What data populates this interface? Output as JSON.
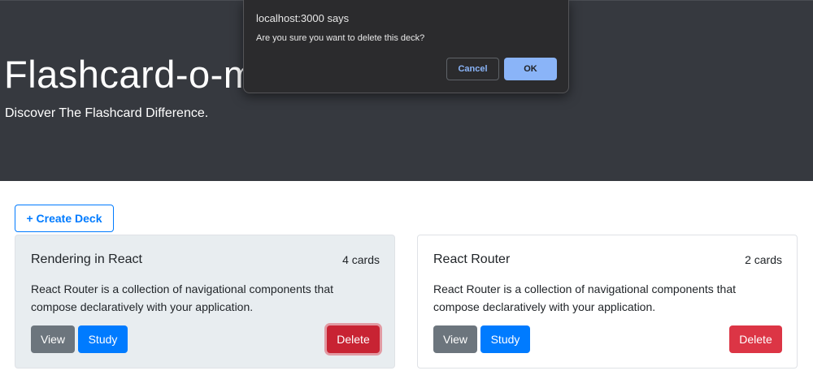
{
  "hero": {
    "title": "Flashcard-o-matic",
    "subtitle": "Discover The Flashcard Difference."
  },
  "create_deck_label": "+ Create Deck",
  "decks": [
    {
      "name": "Rendering in React",
      "count": "4 cards",
      "description": "React Router is a collection of navigational components that compose declaratively with your application.",
      "view_label": "View",
      "study_label": "Study",
      "delete_label": "Delete"
    },
    {
      "name": "React Router",
      "count": "2 cards",
      "description": "React Router is a collection of navigational components that compose declaratively with your application.",
      "view_label": "View",
      "study_label": "Study",
      "delete_label": "Delete"
    }
  ],
  "dialog": {
    "origin": "localhost:3000 says",
    "message": "Are you sure you want to delete this deck?",
    "cancel_label": "Cancel",
    "ok_label": "OK"
  },
  "colors": {
    "hero_bg": "#36393f",
    "primary": "#007bff",
    "secondary": "#6c757d",
    "danger": "#dc3545",
    "dialog_bg": "#2b2b2d",
    "dialog_accent": "#8ab4f8"
  }
}
